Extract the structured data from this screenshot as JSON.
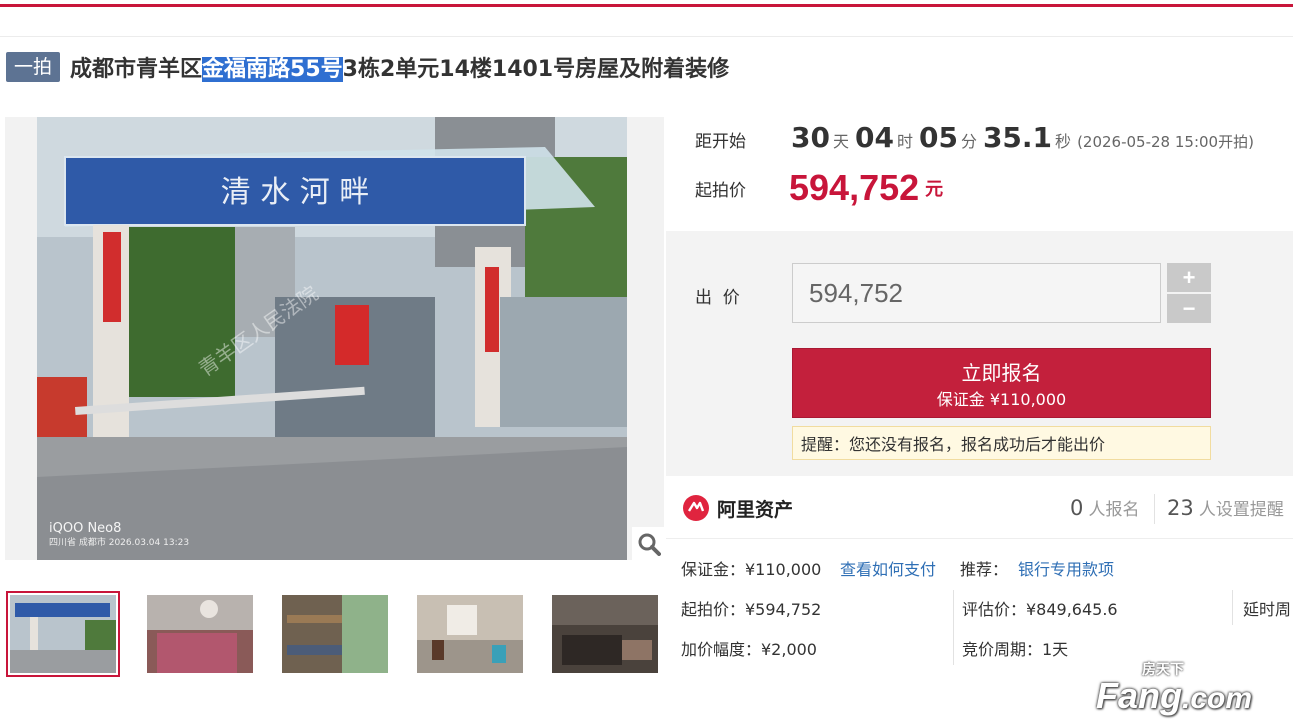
{
  "header": {
    "badge": "一拍",
    "title_pre": "成都市青羊区",
    "title_hl": "金福南路55号",
    "title_post": "3栋2单元14楼1401号房屋及附着装修"
  },
  "countdown": {
    "label": "距开始",
    "days": "30",
    "days_unit": "天",
    "hours": "04",
    "hours_unit": "时",
    "mins": "05",
    "mins_unit": "分",
    "secs": "35.1",
    "secs_unit": "秒",
    "start_note": "(2026-05-28 15:00开拍)"
  },
  "price": {
    "label": "起拍价",
    "value": "594,752",
    "unit": "元"
  },
  "bid": {
    "label": "出  价",
    "input_value": "594,752",
    "plus": "+",
    "minus": "−",
    "register_main": "立即报名",
    "register_sub": "保证金 ¥110,000",
    "reminder": "提醒：您还没有报名，报名成功后才能出价"
  },
  "platform": {
    "name": "阿里资产",
    "signup_count": "0",
    "signup_label": "人报名",
    "remind_count": "23",
    "remind_label": "人设置提醒"
  },
  "details": {
    "deposit": "保证金：¥110,000",
    "pay_link": "查看如何支付",
    "recommend_label": "推荐：",
    "recommend_link": "银行专用款项",
    "start_price": "起拍价：¥594,752",
    "appraisal": "评估价：¥849,645.6",
    "delay": "延时周",
    "increment": "加价幅度：¥2,000",
    "cycle": "竞价周期：1天"
  },
  "photo": {
    "sign_text": "清 水 河 畔",
    "watermark": "青羊区人民法院",
    "camera": "iQOO Neo8",
    "stamp": "四川省 成都市  2026.03.04 13:23"
  },
  "watermark_logo": {
    "top": "房天下",
    "main": "Fang",
    "suffix": ".com"
  },
  "colors": {
    "accent": "#c3203c",
    "price": "#c8153a",
    "link": "#2f6fb5",
    "badge": "#5d7393"
  }
}
